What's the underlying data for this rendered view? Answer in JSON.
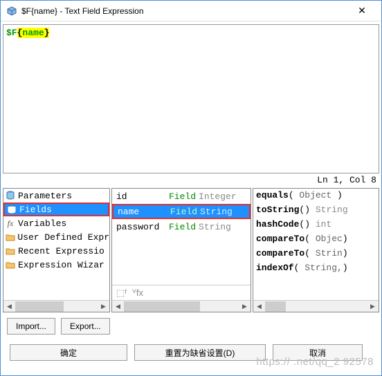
{
  "window": {
    "title": "$F{name} - Text Field Expression",
    "close": "✕"
  },
  "editor": {
    "prefix": "$F",
    "open": "{",
    "var": "name",
    "close": "}"
  },
  "status": {
    "text": "Ln 1, Col 8"
  },
  "left_pane": {
    "items": [
      {
        "label": "Parameters",
        "icon": "db"
      },
      {
        "label": "Fields",
        "icon": "db",
        "selected": true
      },
      {
        "label": "Variables",
        "icon": "fx"
      },
      {
        "label": "User Defined Expr",
        "icon": "folder"
      },
      {
        "label": "Recent Expressio",
        "icon": "folder"
      },
      {
        "label": "Expression Wizar",
        "icon": "folder"
      }
    ]
  },
  "center_pane": {
    "rows": [
      {
        "name": "id",
        "type_lbl": "Field",
        "type_val": "Integer",
        "selected": false
      },
      {
        "name": "name",
        "type_lbl": "Field",
        "type_val": "String",
        "selected": true
      },
      {
        "name": "password",
        "type_lbl": "Field",
        "type_val": "String",
        "selected": false
      }
    ]
  },
  "right_pane": {
    "methods": [
      {
        "name": "equals",
        "args": " Object ",
        "ret": ""
      },
      {
        "name": "toString",
        "args": "",
        "ret": " String"
      },
      {
        "name": "hashCode",
        "args": "",
        "ret": " int"
      },
      {
        "name": "compareTo",
        "args": " Objec",
        "ret": ""
      },
      {
        "name": "compareTo",
        "args": " Strin",
        "ret": ""
      },
      {
        "name": "indexOf",
        "args": " String,",
        "ret": ""
      }
    ]
  },
  "buttons": {
    "import": "Import...",
    "export": "Export...",
    "ok": "确定",
    "reset": "重置为缺省设置(D)",
    "cancel": "取消"
  },
  "watermark": "https://           .net/qq_2   92578"
}
